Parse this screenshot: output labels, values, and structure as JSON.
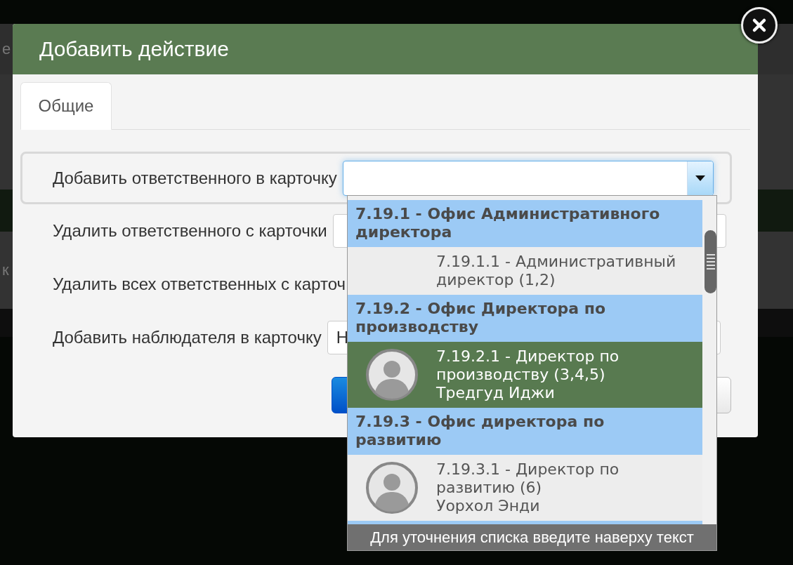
{
  "background": {
    "fragments": [
      "е",
      "к"
    ]
  },
  "dialog": {
    "title": "Добавить действие"
  },
  "tabs": [
    {
      "label": "Общие",
      "selected": true
    }
  ],
  "rows": [
    {
      "label": "Добавить ответственного в карточку",
      "kind": "select",
      "active": true
    },
    {
      "label": "Удалить ответственного с карточки",
      "kind": "input",
      "active": false
    },
    {
      "label": "Удалить всех ответственных с карточ",
      "kind": "text",
      "active": false
    },
    {
      "label": "Добавить наблюдателя в карточку",
      "kind": "input",
      "value": "Н",
      "active": false
    }
  ],
  "buttons": [
    {
      "kind": "primary"
    },
    {
      "kind": "default"
    }
  ],
  "dropdown": {
    "groups": [
      {
        "header": "7.19.1 - Офис Административного директора",
        "options": [
          {
            "title": "7.19.1.1 - Административный директор (1,2)",
            "avatar": false,
            "selected": false
          }
        ]
      },
      {
        "header": "7.19.2 - Офис Директора по производству",
        "options": [
          {
            "title": "7.19.2.1 - Директор по производству (3,4,5)",
            "person": "Тредгуд Иджи",
            "avatar": true,
            "selected": true
          }
        ]
      },
      {
        "header": "7.19.3 - Офис директора по развитию",
        "options": [
          {
            "title": "7.19.3.1 - Директор по развитию (6)",
            "person": "Уорхол Энди",
            "avatar": true,
            "selected": false
          }
        ]
      }
    ],
    "hint": "Для уточнения списка введите наверху текст"
  }
}
